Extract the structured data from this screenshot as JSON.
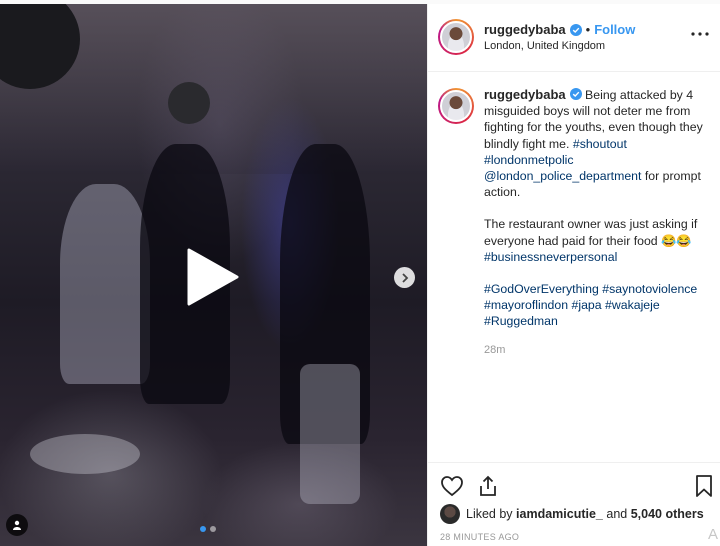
{
  "post": {
    "username": "ruggedybaba",
    "follow_label": "Follow",
    "separator": "•",
    "location": "London, United Kingdom"
  },
  "caption": {
    "username": "ruggedybaba",
    "line1_text": "Being attacked by 4 misguided boys will not deter me from fighting for the youths, even though they blindly fight me.",
    "tags1": [
      "#shoutout",
      "#londonmetpolic",
      "@london_police_department"
    ],
    "line1_tail": "for prompt action.",
    "para2": "The restaurant owner was just asking if everyone had paid for their food 😂😂",
    "tag_business": "#businessneverpersonal",
    "tags3": [
      "#GodOverEverything",
      "#saynotoviolence",
      "#mayoroflindon",
      "#japa",
      "#wakajeje",
      "#Ruggedman"
    ],
    "time_ago": "28m"
  },
  "likes": {
    "prefix": "Liked by",
    "user": "iamdamicutie_",
    "and": "and",
    "others": "5,040 others"
  },
  "posted": "28 MINUTES AGO",
  "cut_char": "A",
  "media": {
    "carousel_total": 2,
    "carousel_active": 1
  },
  "icons": {
    "play": "play-icon",
    "next": "chevron-right-icon",
    "tag": "user-tag-icon",
    "verified": "verified-badge-icon",
    "more": "more-options-icon",
    "like": "heart-icon",
    "share": "share-icon",
    "save": "bookmark-icon"
  },
  "colors": {
    "link": "#3897f0",
    "hashtag": "#003569",
    "muted": "#999999"
  }
}
